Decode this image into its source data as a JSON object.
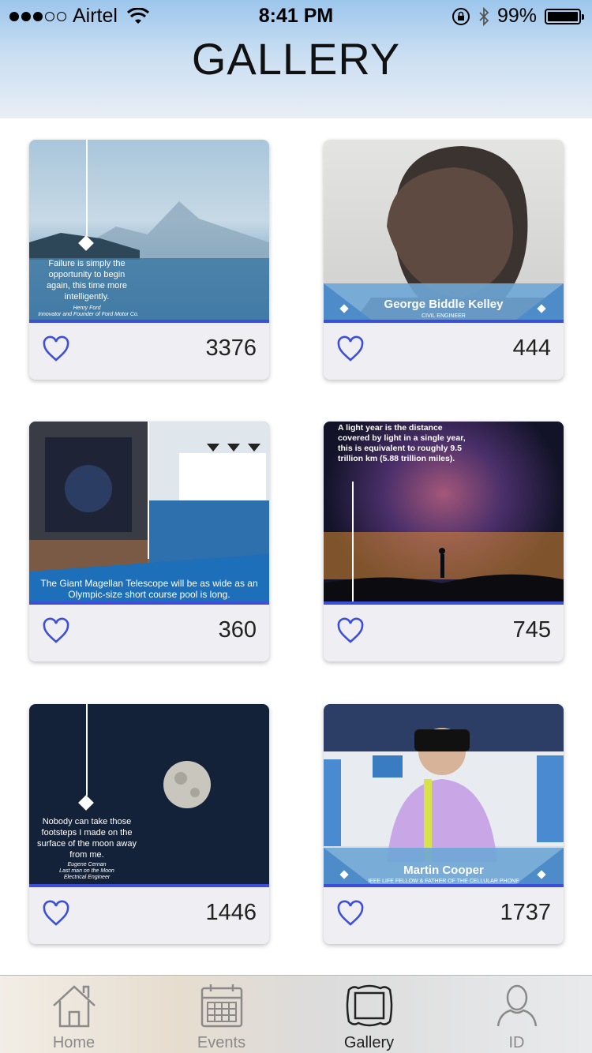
{
  "status_bar": {
    "carrier": "Airtel",
    "time": "8:41 PM",
    "battery": "99%"
  },
  "header": {
    "title": "GALLERY"
  },
  "cards": [
    {
      "likes": "3376",
      "quote": "Failure is simply the opportunity to begin again, this time more intelligently.",
      "author": "Henry Ford",
      "author_title": "Innovator and Founder of Ford Motor Co."
    },
    {
      "likes": "444",
      "name": "George Biddle Kelley",
      "subtitle": "CIVIL ENGINEER"
    },
    {
      "likes": "360",
      "caption": "The Giant Magellan Telescope will be as wide as an Olympic-size short course pool is long."
    },
    {
      "likes": "745",
      "caption": "A light year is the distance covered by light in a single year, this is equivalent to roughly 9.5 trillion km (5.88 trillion miles)."
    },
    {
      "likes": "1446",
      "quote": "Nobody can take those footsteps I made on the surface of the moon away from me.",
      "author": "Eugene Cernan",
      "author_title": "Last man on the Moon",
      "author_title2": "Electrical Engineer"
    },
    {
      "likes": "1737",
      "name": "Martin Cooper",
      "subtitle": "IEEE LIFE FELLOW & FATHER OF THE CELLULAR PHONE"
    }
  ],
  "tabs": [
    {
      "label": "Home",
      "icon": "home-icon"
    },
    {
      "label": "Events",
      "icon": "calendar-icon"
    },
    {
      "label": "Gallery",
      "icon": "gallery-icon",
      "active": true
    },
    {
      "label": "ID",
      "icon": "profile-icon"
    }
  ],
  "colors": {
    "accent_bar": "#3d4fd8",
    "heart": "#3d4fd8",
    "card_bg": "#efeef3"
  }
}
